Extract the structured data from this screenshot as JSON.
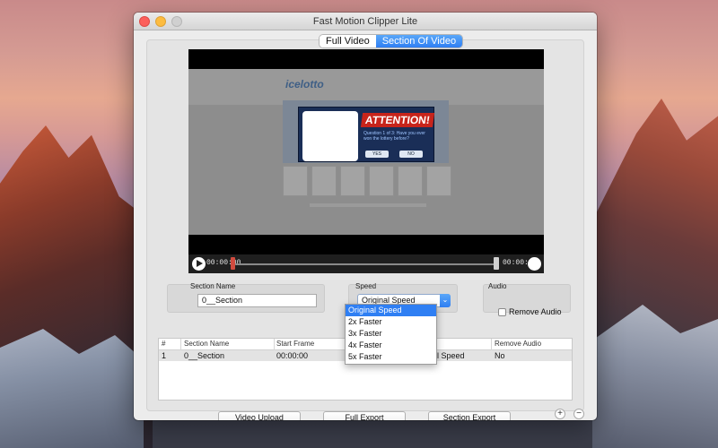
{
  "window": {
    "title": "Fast Motion Clipper Lite"
  },
  "tabs": [
    {
      "label": "Full Video",
      "active": false
    },
    {
      "label": "Section Of Video",
      "active": true
    }
  ],
  "video": {
    "ad": {
      "logo": "icelotto",
      "headline": "ATTENTION!",
      "question": "Question 1 of 3: Have you ever won the lottery before?",
      "yes": "YES",
      "no": "NO"
    },
    "current_time": "00:00:00",
    "total_time": "00:00:23"
  },
  "section_name_group": {
    "label": "Section Name",
    "value": "0__Section"
  },
  "speed_group": {
    "label": "Speed",
    "selected": "Original Speed",
    "options": [
      "Original Speed",
      "2x Faster",
      "3x Faster",
      "4x Faster",
      "5x Faster"
    ]
  },
  "audio_group": {
    "label": "Audio",
    "checkbox_label": "Remove Audio",
    "checked": false
  },
  "table": {
    "columns": [
      "#",
      "Section Name",
      "Start Frame",
      "Remove Audio"
    ],
    "rows": [
      {
        "num": "1",
        "name": "0__Section",
        "start": "00:00:00",
        "speed_partial": "l Speed",
        "remove_audio": "No"
      }
    ]
  },
  "buttons": {
    "video_upload": "Video Upload",
    "full_export": "Full Export",
    "section_export": "Section Export",
    "add": "+",
    "remove": "−"
  },
  "colors": {
    "accent": "#2f7ff3",
    "close": "#fc605c",
    "minimize": "#fdbc40"
  }
}
